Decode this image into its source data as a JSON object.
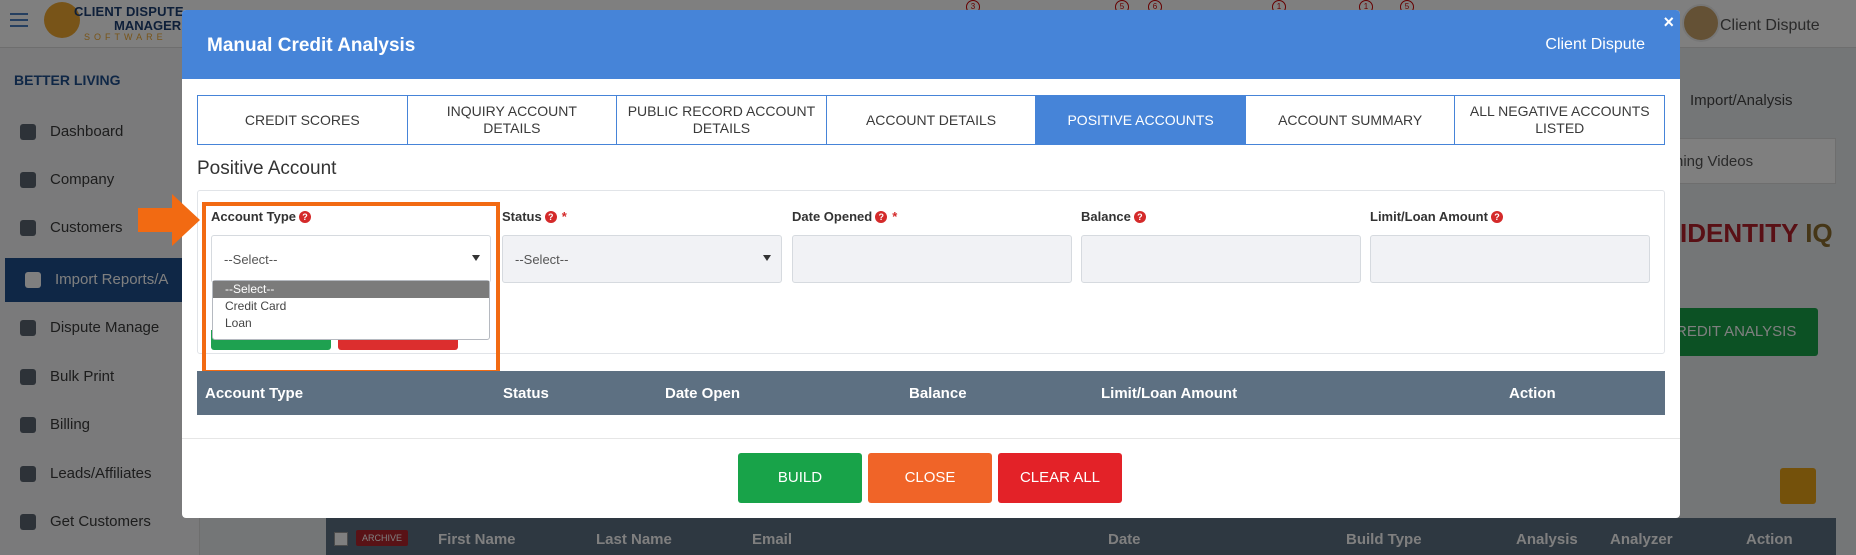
{
  "app": {
    "logo_line1": "CLIENT DISPUTE",
    "logo_line2": "MANAGER",
    "logo_line3": "SOFTWARE",
    "user_name": "Client Dispute",
    "badges": [
      "3",
      "5",
      "6",
      "1",
      "1",
      "5"
    ]
  },
  "sidebar": {
    "org_name": "BETTER LIVING",
    "items": [
      {
        "label": "Dashboard",
        "icon": "dashboard-icon"
      },
      {
        "label": "Company",
        "icon": "building-icon"
      },
      {
        "label": "Customers",
        "icon": "users-icon"
      },
      {
        "label": "Import Reports/A",
        "icon": "import-icon"
      },
      {
        "label": "Dispute Manage",
        "icon": "monitor-icon"
      },
      {
        "label": "Bulk Print",
        "icon": "print-icon"
      },
      {
        "label": "Billing",
        "icon": "invoice-icon"
      },
      {
        "label": "Leads/Affiliates",
        "icon": "chart-icon"
      },
      {
        "label": "Get Customers",
        "icon": "graduation-cap-icon"
      }
    ]
  },
  "background": {
    "breadcrumb": "Import/Analysis",
    "videos_select": "ning Videos",
    "identity_text1": "IDENTITY ",
    "identity_text2": "IQ",
    "credit_button": "REDIT ANALYSIS",
    "archive_label": "ARCHIVE",
    "table_columns": [
      "First Name",
      "Last Name",
      "Email",
      "Date",
      "Build Type",
      "Analysis",
      "Analyzer",
      "Action"
    ]
  },
  "modal": {
    "title": "Manual Credit Analysis",
    "client": "Client Dispute",
    "close_symbol": "×",
    "tabs": [
      "CREDIT SCORES",
      "INQUIRY ACCOUNT DETAILS",
      "PUBLIC RECORD ACCOUNT DETAILS",
      "ACCOUNT DETAILS",
      "POSITIVE ACCOUNTS",
      "ACCOUNT SUMMARY",
      "ALL NEGATIVE ACCOUNTS LISTED"
    ],
    "active_tab": 4,
    "section_title": "Positive Account",
    "fields": {
      "account_type": {
        "label": "Account Type",
        "value": "--Select--"
      },
      "status": {
        "label": "Status",
        "value": "--Select--"
      },
      "date_opened": {
        "label": "Date Opened",
        "value": ""
      },
      "balance": {
        "label": "Balance",
        "value": ""
      },
      "limit": {
        "label": "Limit/Loan Amount",
        "value": ""
      }
    },
    "help_symbol": "?",
    "required_symbol": "*",
    "account_type_options": [
      "--Select--",
      "Credit Card",
      "Loan"
    ],
    "table_columns": [
      "Account Type",
      "Status",
      "Date Open",
      "Balance",
      "Limit/Loan Amount",
      "Action"
    ],
    "buttons": {
      "build": "BUILD",
      "close": "CLOSE",
      "clear_all": "CLEAR ALL"
    }
  },
  "colors": {
    "header_blue": "#4684d8",
    "highlight_orange": "#f26a12",
    "build_green": "#18a349",
    "close_orange": "#f06428",
    "clear_red": "#e32228"
  }
}
